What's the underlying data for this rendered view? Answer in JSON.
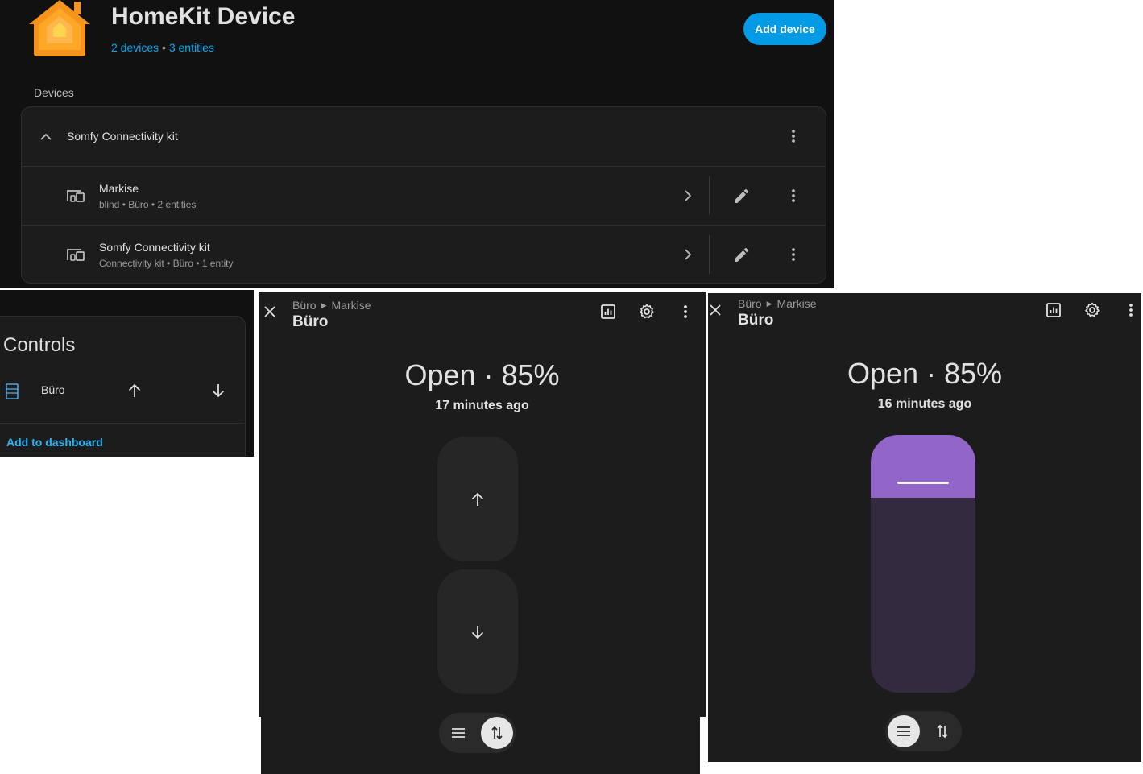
{
  "integration": {
    "title": "HomeKit Device",
    "devices_link": "2 devices",
    "separator": " • ",
    "entities_link": "3 entities",
    "add_device_label": "Add device",
    "section_label": "Devices",
    "group": {
      "name": "Somfy Connectivity kit"
    },
    "devices": [
      {
        "name": "Markise",
        "details": "blind • Büro • 2 entities"
      },
      {
        "name": "Somfy Connectivity kit",
        "details": "Connectivity kit • Büro • 1 entity"
      }
    ]
  },
  "controls": {
    "title": "Controls",
    "entity_name": "Büro",
    "add_to_dashboard": "Add to dashboard"
  },
  "dialog_a": {
    "breadcrumb_area": "Büro",
    "breadcrumb_device": "Markise",
    "title": "Büro",
    "state": "Open · 85%",
    "last_changed": "17 minutes ago",
    "mode": "buttons"
  },
  "dialog_b": {
    "breadcrumb_area": "Büro",
    "breadcrumb_device": "Markise",
    "title": "Büro",
    "state": "Open · 85%",
    "last_changed": "16 minutes ago",
    "mode": "position",
    "position_percent": 85
  },
  "colors": {
    "accent": "#039be5",
    "link": "#03a9f4",
    "cover_active": "#9166c8",
    "background": "#111111",
    "card": "#1c1c1c"
  }
}
